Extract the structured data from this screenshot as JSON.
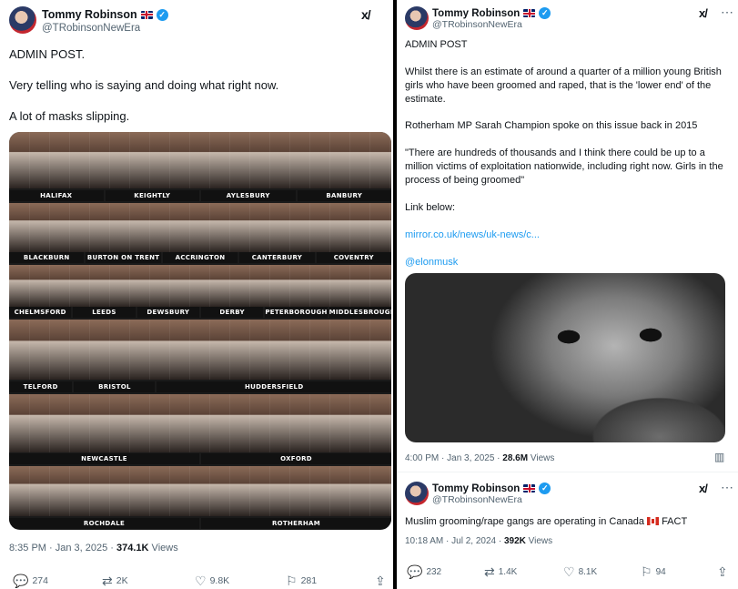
{
  "left_tweet": {
    "author_name": "Tommy Robinson",
    "handle": "@TRobinsonNewEra",
    "lines": [
      "ADMIN POST.",
      "Very telling who is saying and doing what right now.",
      "A lot of masks slipping."
    ],
    "collage_labels": [
      [
        "HALIFAX",
        "KEIGHTLY",
        "AYLESBURY",
        "BANBURY"
      ],
      [
        "BLACKBURN",
        "BURTON ON TRENT",
        "ACCRINGTON",
        "CANTERBURY",
        "COVENTRY"
      ],
      [
        "CHELMSFORD",
        "LEEDS",
        "DEWSBURY",
        "DERBY",
        "PETERBOROUGH",
        "MIDDLESBROUGH"
      ],
      [
        "TELFORD",
        "BRISTOL",
        "HUDDERSFIELD"
      ],
      [
        "NEWCASTLE",
        "OXFORD"
      ],
      [
        "ROCHDALE",
        "ROTHERHAM"
      ]
    ],
    "time": "8:35 PM · Jan 3, 2025 · ",
    "views_count": "374.1K",
    "views_label": " Views",
    "replies": "274",
    "reposts": "2K",
    "likes": "9.8K",
    "bookmarks": "281"
  },
  "right_tweet": {
    "author_name": "Tommy Robinson",
    "handle": "@TRobinsonNewEra",
    "p1": "ADMIN POST",
    "p2": "Whilst there is an estimate of around a quarter of a million young British girls who have been groomed and raped, that is the 'lower end' of the estimate.",
    "p3": "Rotherham MP Sarah Champion spoke on this issue back in 2015",
    "p4": "\"There are hundreds of thousands and I think there could be up to a million victims of exploitation nationwide, including right now. Girls in the process of being groomed\"",
    "p5": "Link below:",
    "link": "mirror.co.uk/news/uk-news/c...",
    "mention": "@elonmusk",
    "time": "4:00 PM · Jan 3, 2025 · ",
    "views_count": "28.6M",
    "views_label": " Views"
  },
  "quoted_tweet": {
    "author_name": "Tommy Robinson",
    "handle": "@TRobinsonNewEra",
    "text": "Muslim grooming/rape gangs are operating in Canada",
    "text_after": " FACT",
    "time": "10:18 AM · Jul 2, 2024 · ",
    "views_count": "392K",
    "views_label": " Views",
    "replies": "232",
    "reposts": "1.4K",
    "likes": "8.1K",
    "bookmarks": "94"
  },
  "icons": {
    "grok": "grok-icon",
    "reply": "reply-icon",
    "repost": "repost-icon",
    "like": "heart-icon",
    "bookmark": "bookmark-icon",
    "share": "share-icon"
  },
  "colors": {
    "accent": "#1d9bf0",
    "text": "#0f1419",
    "muted": "#536471"
  }
}
